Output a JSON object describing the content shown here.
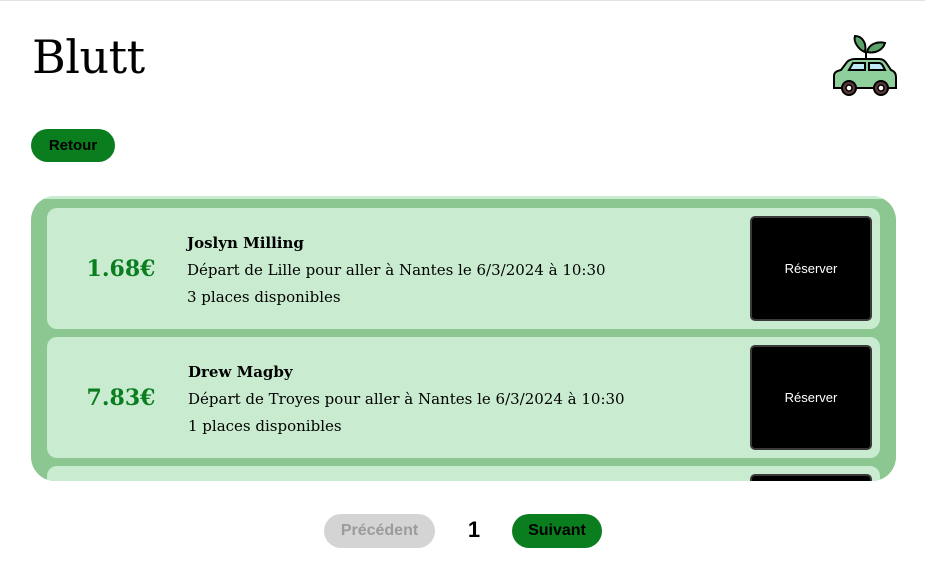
{
  "header": {
    "title": "Blutt",
    "logo_icon": "eco-car-icon"
  },
  "back_button": {
    "label": "Retour"
  },
  "trips": [
    {
      "price": "1.68€",
      "driver": "Joslyn Milling",
      "route": "Départ de Lille pour aller à Nantes le 6/3/2024 à 10:30",
      "seats": "3 places disponibles",
      "reserve_label": "Réserver"
    },
    {
      "price": "7.83€",
      "driver": "Drew Magby",
      "route": "Départ de Troyes pour aller à Nantes le 6/3/2024 à 10:30",
      "seats": "1 places disponibles",
      "reserve_label": "Réserver"
    },
    {
      "price": "",
      "driver": "",
      "route": "",
      "seats": "",
      "reserve_label": ""
    }
  ],
  "pagination": {
    "prev_label": "Précédent",
    "page": "1",
    "next_label": "Suivant"
  },
  "colors": {
    "accent": "#0a7d1f",
    "panel": "#8cc792",
    "card": "#c9ecd0",
    "disabled": "#d4d4d4"
  }
}
